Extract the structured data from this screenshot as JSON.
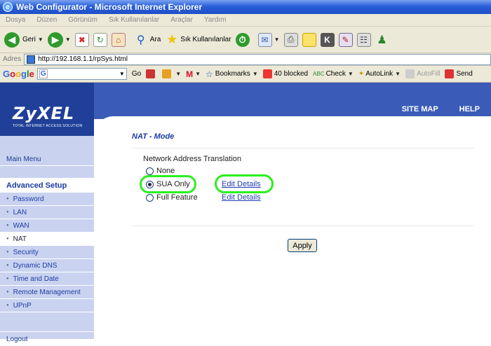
{
  "window": {
    "title": "Web Configurator - Microsoft Internet Explorer"
  },
  "menubar": {
    "items": [
      "Dosya",
      "Düzen",
      "Görünüm",
      "Sık Kullanılanlar",
      "Araçlar",
      "Yardım"
    ]
  },
  "toolbar": {
    "back": "Geri",
    "search": "Ara",
    "favorites": "Sık Kullanılanlar"
  },
  "address": {
    "label": "Adres",
    "url": "http://192.168.1.1/rpSys.html"
  },
  "googlebar": {
    "logo": "Google",
    "search_prefix": "G",
    "go": "Go",
    "bookmarks": "Bookmarks",
    "blocked": "40 blocked",
    "check": "Check",
    "autolink": "AutoLink",
    "autofill": "AutoFill",
    "send": "Send"
  },
  "brand": {
    "logo": "ZyXEL",
    "tagline": "TOTAL INTERNET ACCESS SOLUTION"
  },
  "toplinks": {
    "sitemap": "SITE MAP",
    "help": "HELP"
  },
  "sidebar": {
    "main_menu": "Main Menu",
    "advanced_setup": "Advanced Setup",
    "items": [
      {
        "label": "Password"
      },
      {
        "label": "LAN"
      },
      {
        "label": "WAN"
      },
      {
        "label": "NAT"
      },
      {
        "label": "Security"
      },
      {
        "label": "Dynamic DNS"
      },
      {
        "label": "Time and Date"
      },
      {
        "label": "Remote Management"
      },
      {
        "label": "UPnP"
      }
    ],
    "logout": "Logout"
  },
  "main": {
    "title": "NAT - Mode",
    "section_label": "Network Address Translation",
    "options": [
      {
        "label": "None",
        "checked": false
      },
      {
        "label": "SUA Only",
        "checked": true
      },
      {
        "label": "Full Feature",
        "checked": false
      }
    ],
    "edit_links": [
      "Edit Details",
      "Edit Details"
    ],
    "apply": "Apply",
    "highlight_color": "#2af01e"
  }
}
